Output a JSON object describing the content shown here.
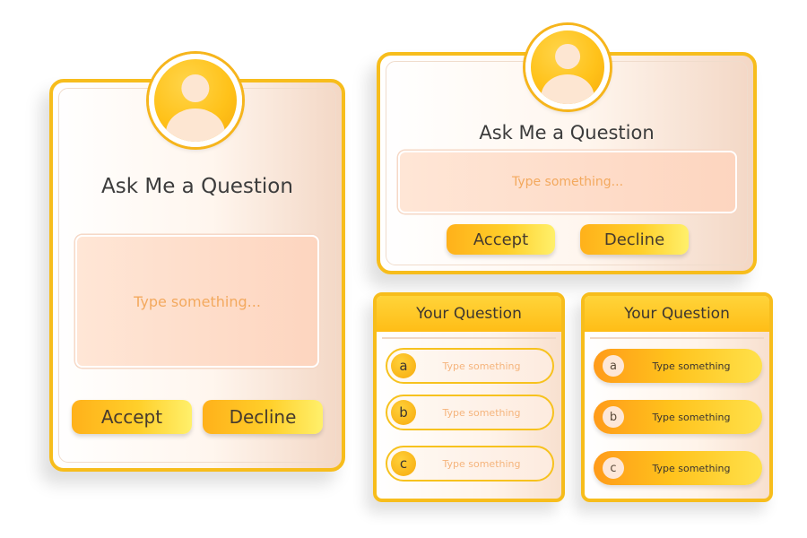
{
  "left_card": {
    "title": "Ask Me a Question",
    "input_placeholder": "Type something...",
    "accept_label": "Accept",
    "decline_label": "Decline"
  },
  "top_right_card": {
    "title": "Ask Me a Question",
    "input_placeholder": "Type something...",
    "accept_label": "Accept",
    "decline_label": "Decline"
  },
  "question_card_outline": {
    "header": "Your Question",
    "options": [
      {
        "letter": "a",
        "text": "Type something"
      },
      {
        "letter": "b",
        "text": "Type something"
      },
      {
        "letter": "c",
        "text": "Type something"
      }
    ]
  },
  "question_card_filled": {
    "header": "Your Question",
    "options": [
      {
        "letter": "a",
        "text": "Type something"
      },
      {
        "letter": "b",
        "text": "Type something"
      },
      {
        "letter": "c",
        "text": "Type something"
      }
    ]
  },
  "colors": {
    "accent": "#f7bd1c",
    "button_gradient_start": "#ffb11a",
    "button_gradient_end": "#fff06b",
    "input_fill": "#fdd5bf",
    "placeholder_text": "#f3a95e",
    "title_text": "#3c3c3c"
  },
  "icons": {
    "avatar": "user-avatar-icon"
  }
}
